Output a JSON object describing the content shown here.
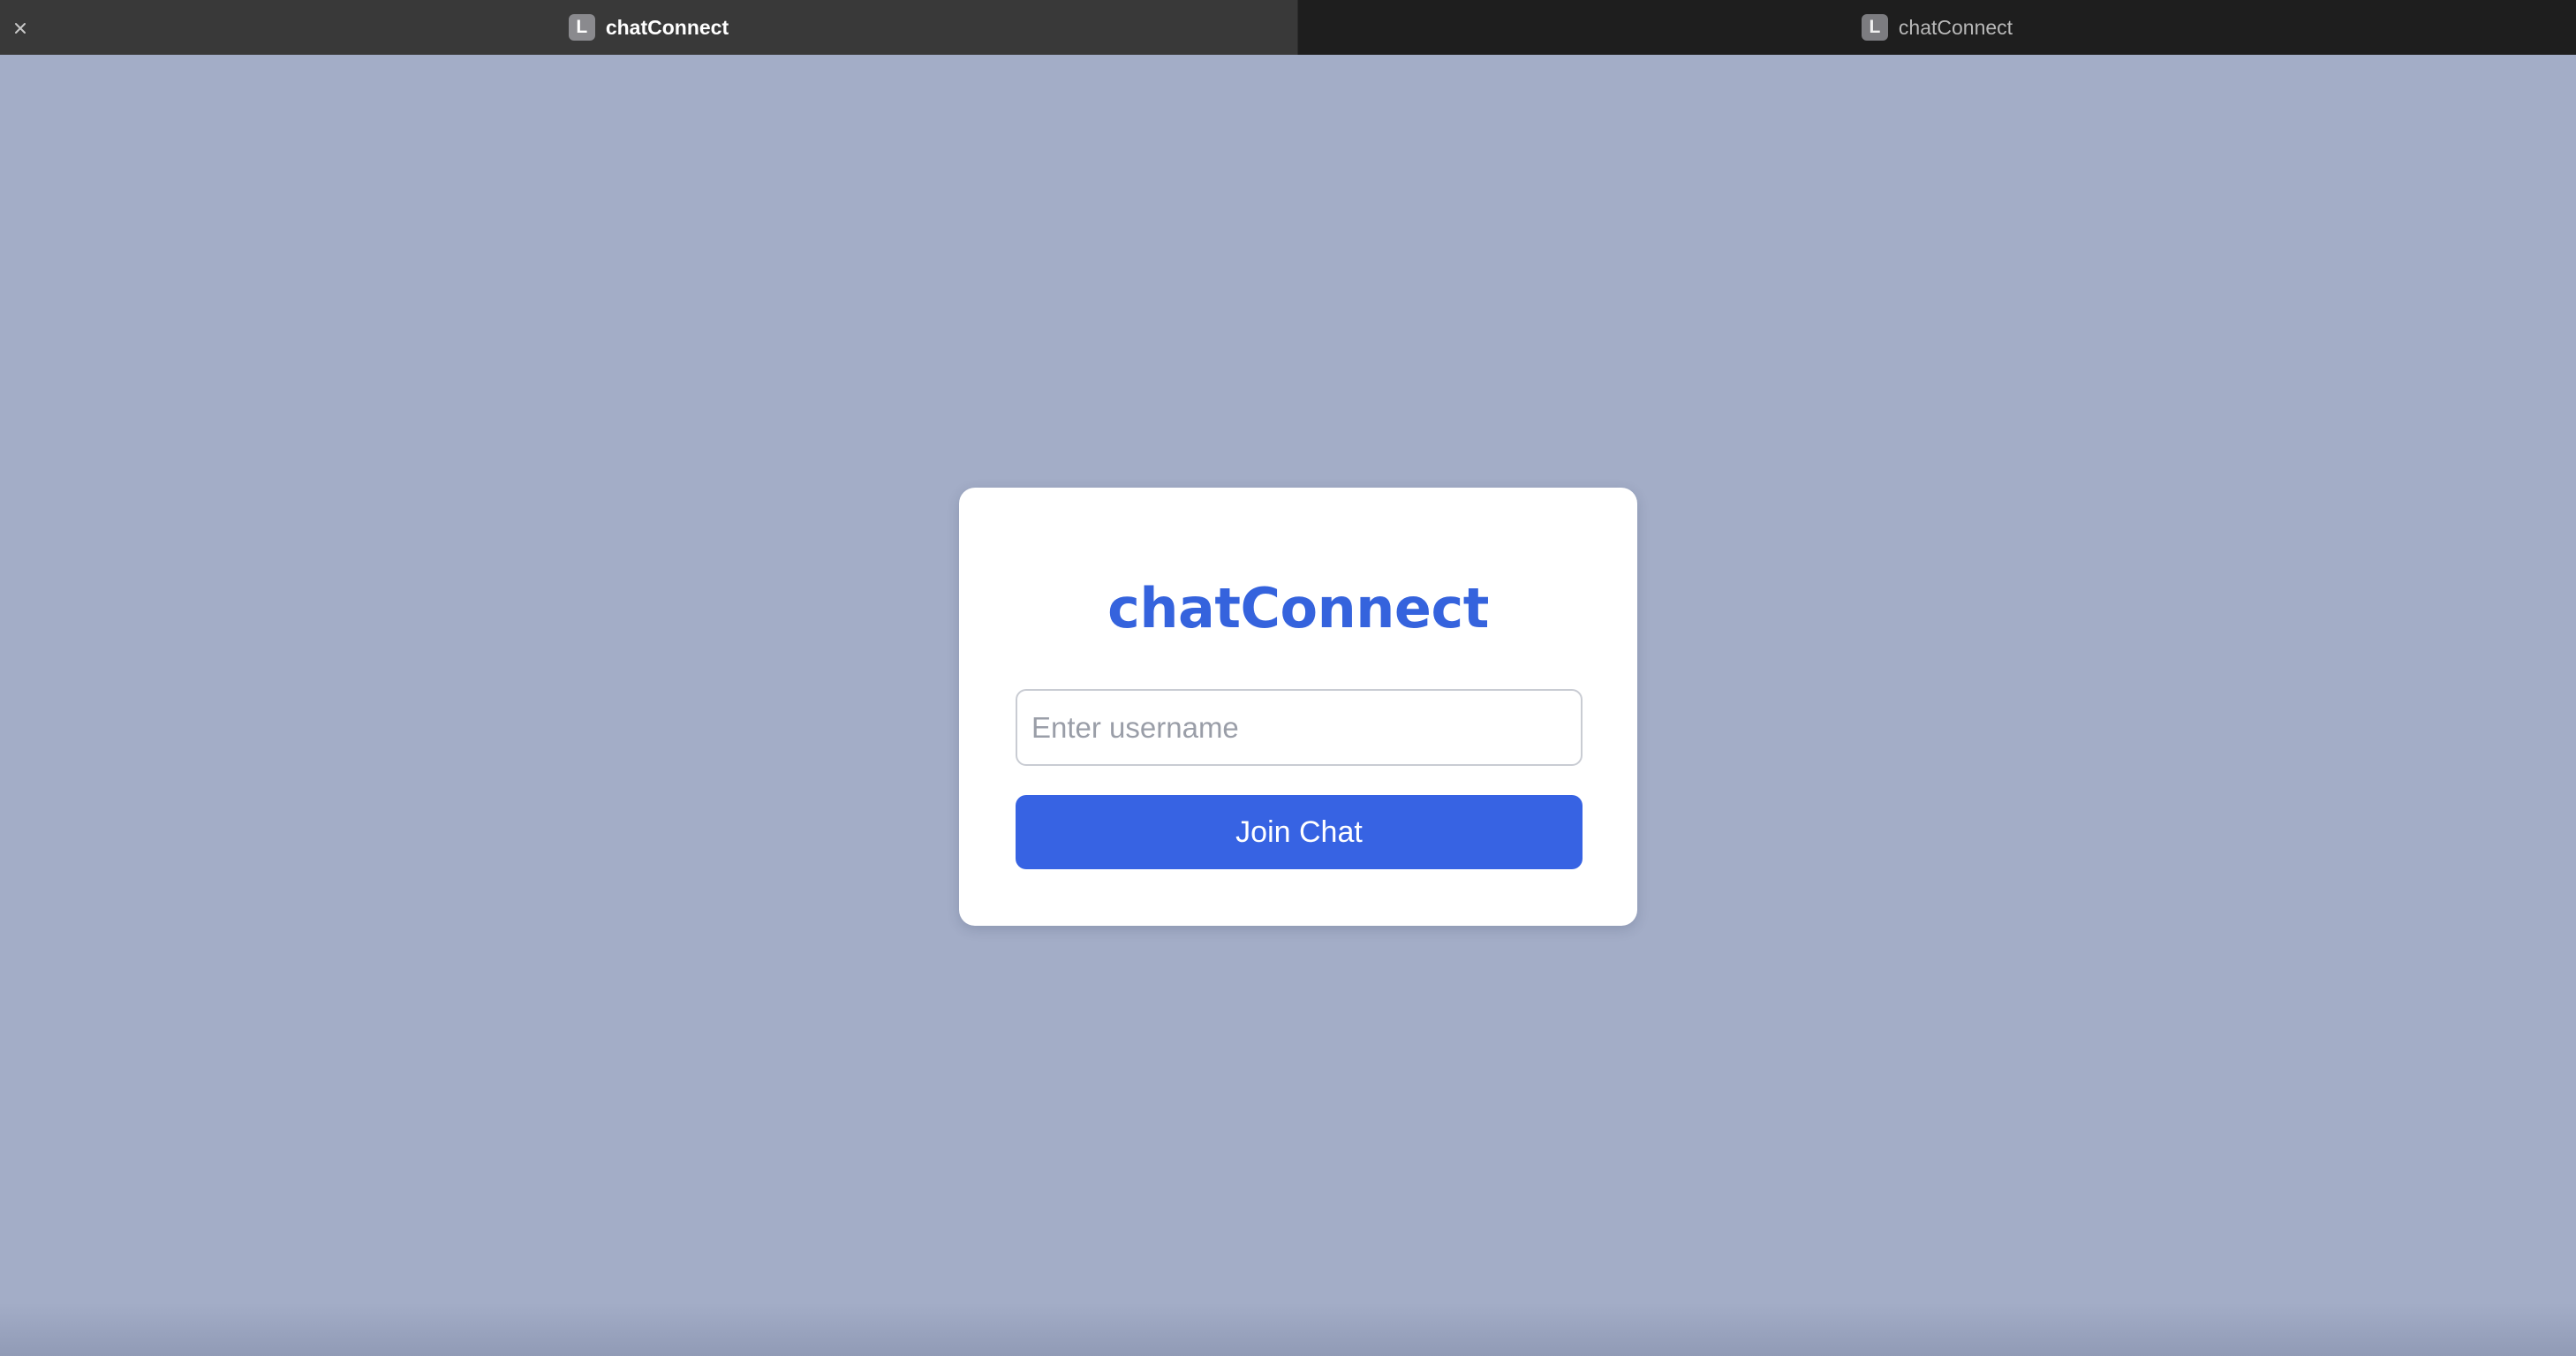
{
  "tabs": [
    {
      "label": "chatConnect",
      "favicon_letter": "L",
      "active": true
    },
    {
      "label": "chatConnect",
      "favicon_letter": "L",
      "active": false
    }
  ],
  "login": {
    "title": "chatConnect",
    "username_placeholder": "Enter username",
    "username_value": "",
    "join_button_label": "Join Chat"
  },
  "colors": {
    "page_background": "#a3adc7",
    "card_background": "#ffffff",
    "brand_blue": "#3563dd",
    "button_blue": "#3763e3",
    "tabbar_background": "#1e1e1e",
    "active_tab_background": "#393939"
  },
  "icons": {
    "tab_close": "close-icon"
  }
}
